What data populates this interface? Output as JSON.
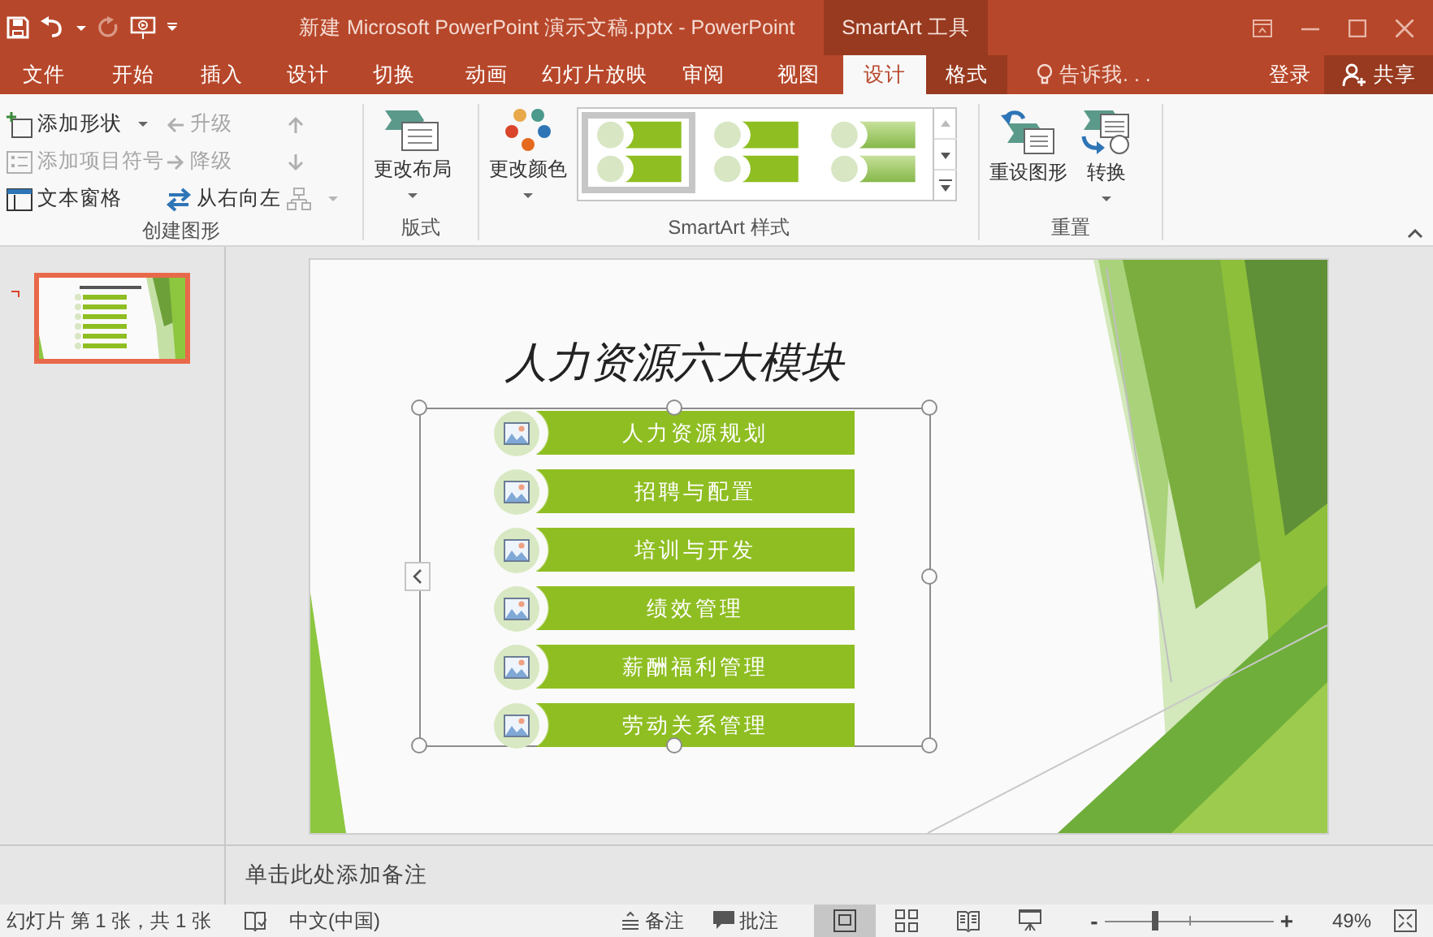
{
  "window": {
    "title": "新建 Microsoft PowerPoint 演示文稿.pptx - PowerPoint",
    "context_tab": "SmartArt 工具"
  },
  "tabs": [
    {
      "label": "文件",
      "selected": false,
      "kind": "file"
    },
    {
      "label": "开始",
      "selected": false,
      "kind": "main"
    },
    {
      "label": "插入",
      "selected": false,
      "kind": "main"
    },
    {
      "label": "设计",
      "selected": false,
      "kind": "main"
    },
    {
      "label": "切换",
      "selected": false,
      "kind": "main"
    },
    {
      "label": "动画",
      "selected": false,
      "kind": "main"
    },
    {
      "label": "幻灯片放映",
      "selected": false,
      "kind": "main"
    },
    {
      "label": "审阅",
      "selected": false,
      "kind": "main"
    },
    {
      "label": "视图",
      "selected": false,
      "kind": "main"
    },
    {
      "label": "设计",
      "selected": true,
      "kind": "context"
    },
    {
      "label": "格式",
      "selected": false,
      "kind": "context"
    }
  ],
  "tell_me": "告诉我. . .",
  "account": {
    "sign_in": "登录",
    "share": "共享"
  },
  "ribbon": {
    "groups": [
      {
        "label": "创建图形",
        "kind": "small-grid",
        "items": [
          {
            "label": "添加形状",
            "disabled": false,
            "dropdown": true
          },
          {
            "label": "添加项目符号",
            "disabled": true,
            "dropdown": false
          },
          {
            "label": "文本窗格",
            "disabled": false,
            "dropdown": false
          },
          {
            "label": "升级",
            "disabled": true,
            "dropdown": false
          },
          {
            "label": "降级",
            "disabled": true,
            "dropdown": false
          },
          {
            "label": "从右向左",
            "disabled": false,
            "dropdown": false
          },
          {
            "disabled": true,
            "dropdown": false
          },
          {
            "disabled": true,
            "dropdown": false
          },
          {
            "disabled": true,
            "dropdown": true
          }
        ]
      },
      {
        "label": "版式",
        "kind": "large",
        "items": [
          {
            "label": "更改布局",
            "disabled": false,
            "dropdown": true
          }
        ]
      },
      {
        "label": "SmartArt 样式",
        "kind": "gallery",
        "items": [
          {
            "label": "更改颜色",
            "disabled": false,
            "dropdown": true
          }
        ],
        "styles": [
          {
            "kind": "flat",
            "selected": true
          },
          {
            "kind": "flat",
            "selected": false
          },
          {
            "kind": "gradient",
            "selected": false
          }
        ]
      },
      {
        "label": "重置",
        "kind": "large",
        "items": [
          {
            "label": "重设图形",
            "disabled": false,
            "dropdown": false
          },
          {
            "label": "转换",
            "disabled": false,
            "dropdown": true
          }
        ]
      }
    ]
  },
  "slides": [
    {
      "selected": true
    }
  ],
  "slide": {
    "title": "人力资源六大模块",
    "smartart_selected": true,
    "items": [
      "人力资源规划",
      "招聘与配置",
      "培训与开发",
      "绩效管理",
      "薪酬福利管理",
      "劳动关系管理"
    ]
  },
  "notes": {
    "placeholder": "单击此处添加备注"
  },
  "status_bar": {
    "slide_info": "幻灯片 第 1 张，共 1 张",
    "language": "中文(中国)",
    "notes": "备注",
    "comments": "批注",
    "views": [
      {
        "kind": "normal",
        "selected": true
      },
      {
        "kind": "sorter",
        "selected": false
      },
      {
        "kind": "reading",
        "selected": false
      },
      {
        "kind": "slideshow",
        "selected": false
      }
    ],
    "zoom": {
      "minus": "-",
      "plus": "+",
      "level": 0.3,
      "reading": "49%"
    }
  }
}
